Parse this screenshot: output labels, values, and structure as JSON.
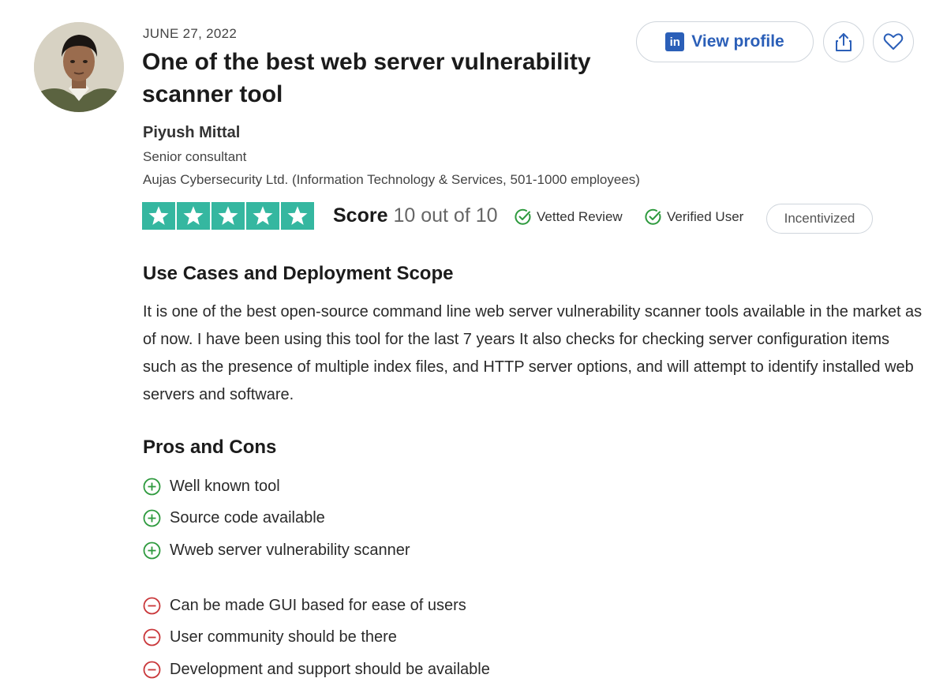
{
  "review": {
    "date": "JUNE 27, 2022",
    "title": "One of the best web server vulnerability scanner tool"
  },
  "reviewer": {
    "name": "Piyush Mittal",
    "role": "Senior consultant",
    "company": "Aujas Cybersecurity Ltd. (Information Technology & Services, 501-1000 employees)"
  },
  "actions": {
    "view_profile_label": "View profile",
    "linkedin_icon_text": "in",
    "share_icon": "share-icon",
    "like_icon": "heart-icon"
  },
  "rating": {
    "stars_filled": 5,
    "stars_total": 5,
    "score_label": "Score",
    "score_value": "10 out of 10"
  },
  "badges": {
    "vetted": "Vetted Review",
    "verified": "Verified User",
    "incentivized": "Incentivized"
  },
  "use_cases": {
    "heading": "Use Cases and Deployment Scope",
    "body": "It is one of the best open-source command line web server vulnerability scanner tools available in the market as of now. I have been using this tool for the last 7 years It also checks for checking server configuration items such as the presence of multiple index files, and HTTP server options, and will attempt to identify installed web servers and software."
  },
  "pros_cons": {
    "heading": "Pros and Cons",
    "pros": [
      "Well known tool",
      "Source code available",
      "Wweb server vulnerability scanner"
    ],
    "cons": [
      "Can be made GUI based for ease of users",
      "User community should be there",
      "Development and support should be available"
    ]
  },
  "colors": {
    "star_green": "#35b7a0",
    "link_blue": "#2b5fb8",
    "pro_green": "#2e9a3e",
    "con_red": "#c9373a"
  }
}
